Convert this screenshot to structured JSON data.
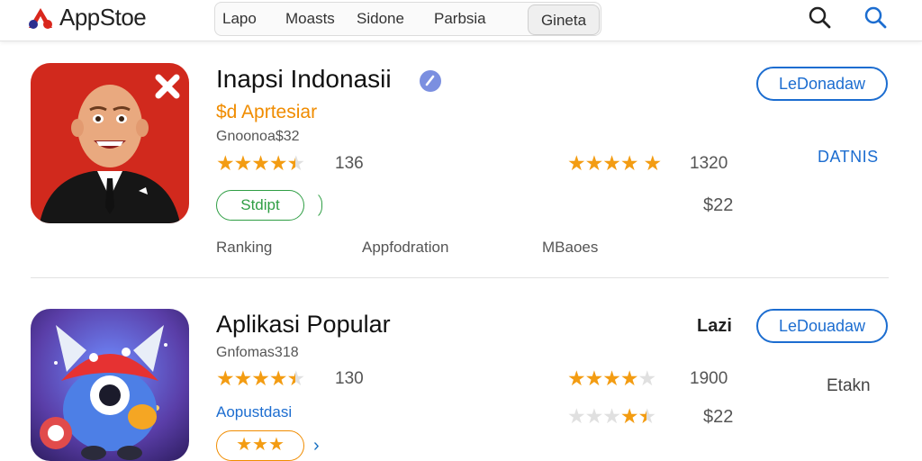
{
  "header": {
    "brand": "AppStoe",
    "tabs": [
      "Lapo",
      "Moasts",
      "Sidone",
      "Parbsia",
      "Gineta"
    ],
    "active_tab": "Gineta",
    "icons": [
      "search-icon",
      "search-icon"
    ]
  },
  "apps": [
    {
      "title": "Inapsi Indonasii",
      "verified": true,
      "developer": "$d Aprtesiar",
      "subtitle": "Gnoonoa$32",
      "rating_left": 4.5,
      "rating_left_count": "136",
      "rating_right": 4,
      "rating_right_count": "1320",
      "chip": "Stdipt",
      "price": "$22",
      "button": "LeDonadaw",
      "side_label": "DATNIS",
      "meta": [
        "Ranking",
        "Appfodration",
        "MBaoes"
      ]
    },
    {
      "title": "Aplikasi Popular",
      "subtitle": "Gnfomas318",
      "rating_left": 4.5,
      "rating_left_count": "130",
      "rating_right": 4,
      "rating_right_count": "1900",
      "rating_small": 3.5,
      "price": "$22",
      "button": "LeDouadaw",
      "side_label_top": "Lazi",
      "side_label": "Etakn",
      "developer": "Aopustdasi",
      "chip": "★★★"
    }
  ],
  "colors": {
    "accent": "#1c6dd0",
    "star": "#f39c12",
    "green": "#2f9e44",
    "orange": "#f08c00"
  }
}
